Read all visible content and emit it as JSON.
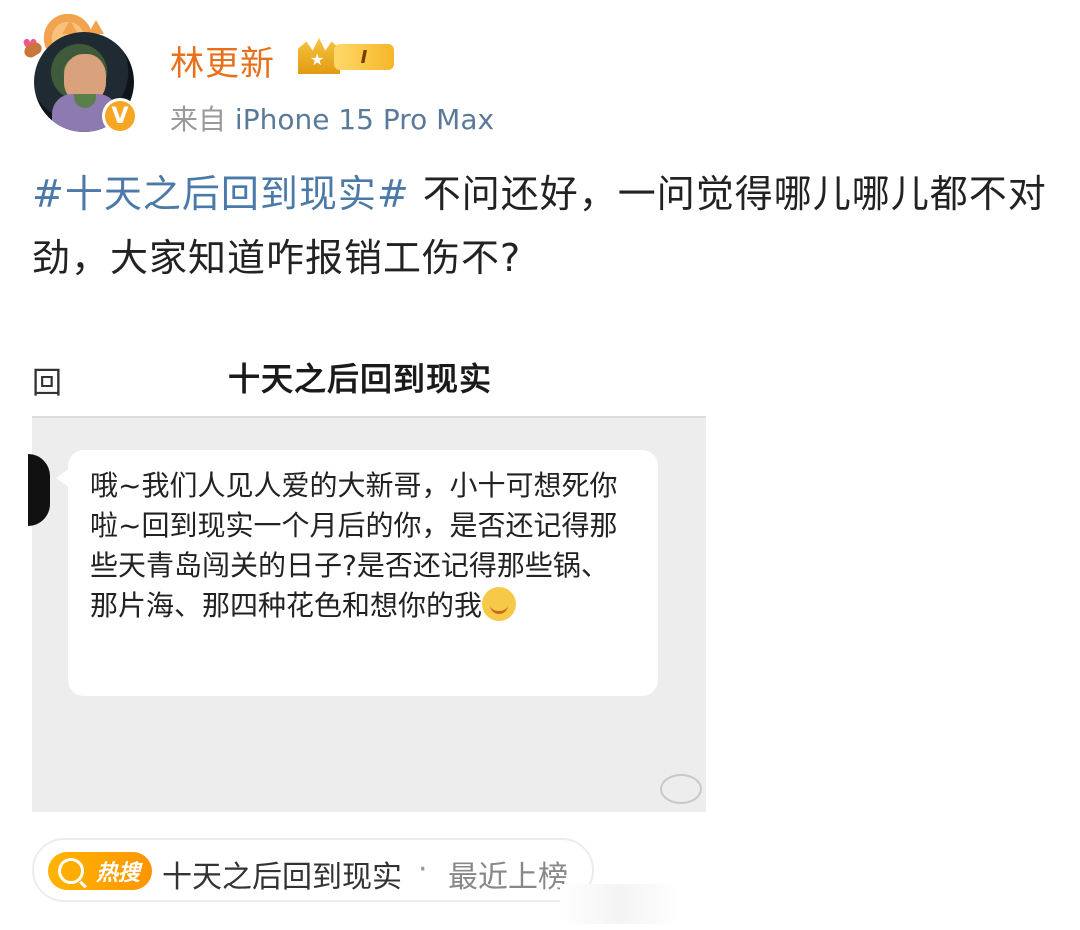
{
  "user": {
    "name": "林更新",
    "level": "I",
    "source_prefix": "来自",
    "device": "iPhone 15 Pro Max"
  },
  "post": {
    "hashtag": "#十天之后回到现实#",
    "text": " 不问还好，一问觉得哪儿哪儿都不对劲，大家知道咋报销工伤不?"
  },
  "screenshot": {
    "back_char": "回",
    "title": "十天之后回到现实",
    "message": "哦~我们人见人爱的大新哥，小十可想死你啦~回到现实一个月后的你，是否还记得那些天青岛闯关的日子?是否还记得那些锅、那片海、那四种花色和想你的我"
  },
  "hot_search": {
    "label": "热搜",
    "topic": "十天之后回到现实",
    "separator": "·",
    "status": "最近上榜"
  },
  "colors": {
    "username": "#e8701a",
    "hashtag": "#4b7aa8",
    "hot_badge": "#ff9500"
  }
}
